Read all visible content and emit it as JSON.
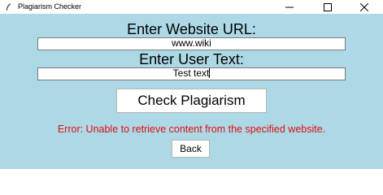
{
  "window": {
    "title": "Plagiarism Checker",
    "controls": {
      "minimize": "minimize",
      "maximize": "maximize",
      "close": "close"
    }
  },
  "form": {
    "url_label": "Enter Website URL:",
    "url_value": "www.wiki",
    "text_label": "Enter User Text:",
    "text_value": "Test text",
    "check_button": "Check Plagiarism"
  },
  "error_message": "Error: Unable to retrieve content from the specified website.",
  "back_button": "Back",
  "colors": {
    "background": "#add8e6",
    "error": "#e01010"
  }
}
